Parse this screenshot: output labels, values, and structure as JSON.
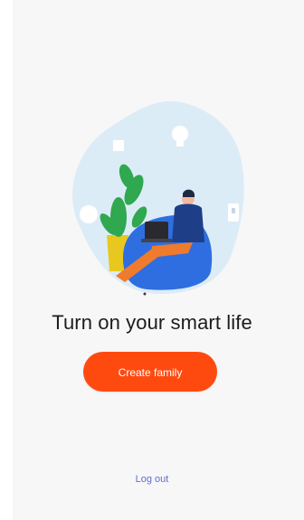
{
  "onboarding": {
    "headline": "Turn on your smart life",
    "create_button_label": "Create family",
    "logout_label": "Log out"
  },
  "illustration": {
    "icons": [
      "lightbulb-icon",
      "plant-icon",
      "laptop-icon",
      "switch-icon",
      "beanbag-icon",
      "person-icon"
    ]
  },
  "colors": {
    "accent": "#ff4a0f",
    "link": "#5b6fd6",
    "blob": "#dcecf7",
    "beanbag": "#2f6ee0",
    "plant": "#2fa84f",
    "pot": "#e8c81f"
  }
}
